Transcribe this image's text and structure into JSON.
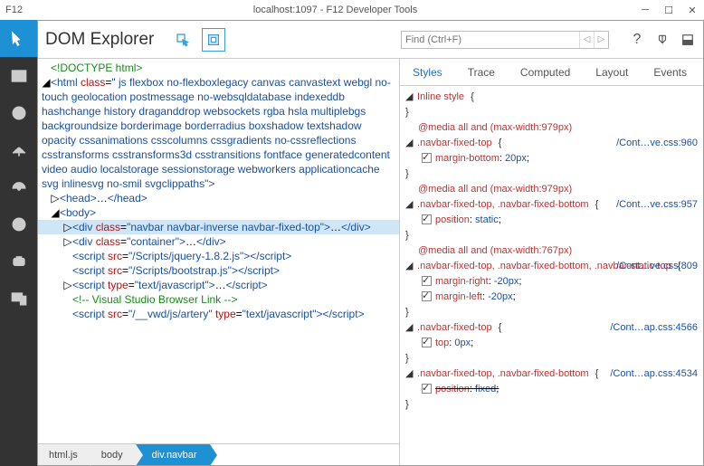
{
  "window": {
    "f12": "F12",
    "title": "localhost:1097 - F12 Developer Tools"
  },
  "panel_title": "DOM Explorer",
  "search": {
    "placeholder": "Find (Ctrl+F)"
  },
  "dom_lines": [
    {
      "ind": 0,
      "tw": "",
      "html": "<span class='c-doctype'>&lt;!DOCTYPE html&gt;</span>"
    },
    {
      "ind": 0,
      "tw": "◢",
      "html": "<span class='c-tag'>&lt;html</span> <span class='c-attr'>class</span>=<span class='c-val'>\" js flexbox no-flexboxlegacy canvas canvastext webgl no-touch geolocation postmessage no-websqldatabase indexeddb hashchange history draganddrop websockets rgba hsla multiplebgs backgroundsize borderimage borderradius boxshadow textshadow opacity cssanimations csscolumns cssgradients no-cssreflections csstransforms csstransforms3d csstransitions fontface generatedcontent video audio localstorage sessionstorage webworkers applicationcache svg inlinesvg no-smil svgclippaths\"</span><span class='c-tag'>&gt;</span>"
    },
    {
      "ind": 1,
      "tw": "▷",
      "html": "<span class='c-tag'>&lt;head&gt;</span><span class='c-text'>…</span><span class='c-tag'>&lt;/head&gt;</span>"
    },
    {
      "ind": 1,
      "tw": "◢",
      "html": "<span class='c-tag'>&lt;body&gt;</span>"
    },
    {
      "ind": 2,
      "tw": "▷",
      "sel": true,
      "html": "<span class='c-tag'>&lt;div</span> <span class='c-attr'>class</span>=<span class='c-val'>\"navbar navbar-inverse navbar-fixed-top\"</span><span class='c-tag'>&gt;</span><span class='c-text'>…</span><span class='c-tag'>&lt;/div&gt;</span>"
    },
    {
      "ind": 2,
      "tw": "▷",
      "html": "<span class='c-tag'>&lt;div</span> <span class='c-attr'>class</span>=<span class='c-val'>\"container\"</span><span class='c-tag'>&gt;</span><span class='c-text'>…</span><span class='c-tag'>&lt;/div&gt;</span>"
    },
    {
      "ind": 2,
      "tw": "",
      "html": "<span class='c-tag'>&lt;script</span> <span class='c-attr'>src</span>=<span class='c-val'>\"/Scripts/jquery-1.8.2.js\"</span><span class='c-tag'>&gt;&lt;/script&gt;</span>"
    },
    {
      "ind": 2,
      "tw": "",
      "html": "<span class='c-tag'>&lt;script</span> <span class='c-attr'>src</span>=<span class='c-val'>\"/Scripts/bootstrap.js\"</span><span class='c-tag'>&gt;&lt;/script&gt;</span>"
    },
    {
      "ind": 2,
      "tw": "▷",
      "html": "<span class='c-tag'>&lt;script</span> <span class='c-attr'>type</span>=<span class='c-val'>\"text/javascript\"</span><span class='c-tag'>&gt;</span><span class='c-text'>…</span><span class='c-tag'>&lt;/script&gt;</span>"
    },
    {
      "ind": 2,
      "tw": "",
      "html": "<span class='c-comment'>&lt;!-- Visual Studio Browser Link --&gt;</span>"
    },
    {
      "ind": 2,
      "tw": "",
      "html": "<span class='c-tag'>&lt;script</span> <span class='c-attr'>src</span>=<span class='c-val'>\"/__vwd/js/artery\"</span> <span class='c-attr'>type</span>=<span class='c-val'>\"text/javascript\"</span><span class='c-tag'>&gt;&lt;/script&gt;</span>"
    }
  ],
  "breadcrumb": [
    {
      "label": "html.js",
      "active": false
    },
    {
      "label": "body",
      "active": false
    },
    {
      "label": "div.navbar",
      "active": true
    }
  ],
  "styles_tabs": [
    {
      "label": "Styles",
      "active": true
    },
    {
      "label": "Trace",
      "active": false
    },
    {
      "label": "Computed",
      "active": false
    },
    {
      "label": "Layout",
      "active": false
    },
    {
      "label": "Events",
      "active": false
    }
  ],
  "rules": [
    {
      "selector": "Inline style",
      "link": "",
      "media": "",
      "props": [],
      "open": true
    },
    {
      "selector": ".navbar-fixed-top",
      "link": "/Cont…ve.css:960",
      "media": "@media all and (max-width:979px)",
      "props": [
        {
          "n": "margin-bottom",
          "v": "20px",
          "c": true
        }
      ],
      "open": true
    },
    {
      "selector": ".navbar-fixed-top, .navbar-fixed-bottom",
      "link": "/Cont…ve.css:957",
      "media": "@media all and (max-width:979px)",
      "props": [
        {
          "n": "position",
          "v": "static",
          "c": true
        }
      ],
      "open": true
    },
    {
      "selector": ".navbar-fixed-top, .navbar-fixed-bottom, .navbar-static-top",
      "link": "/Cont…ve.css:809",
      "media": "@media all and (max-width:767px)",
      "props": [
        {
          "n": "margin-right",
          "v": "-20px",
          "c": true
        },
        {
          "n": "margin-left",
          "v": "-20px",
          "c": true
        }
      ],
      "open": true
    },
    {
      "selector": ".navbar-fixed-top",
      "link": "/Cont…ap.css:4566",
      "media": "",
      "props": [
        {
          "n": "top",
          "v": "0px",
          "c": true
        }
      ],
      "open": true
    },
    {
      "selector": ".navbar-fixed-top, .navbar-fixed-bottom",
      "link": "/Cont…ap.css:4534",
      "media": "",
      "props": [
        {
          "n": "position",
          "v": "fixed",
          "c": true,
          "struck": true
        }
      ],
      "open": true
    }
  ]
}
